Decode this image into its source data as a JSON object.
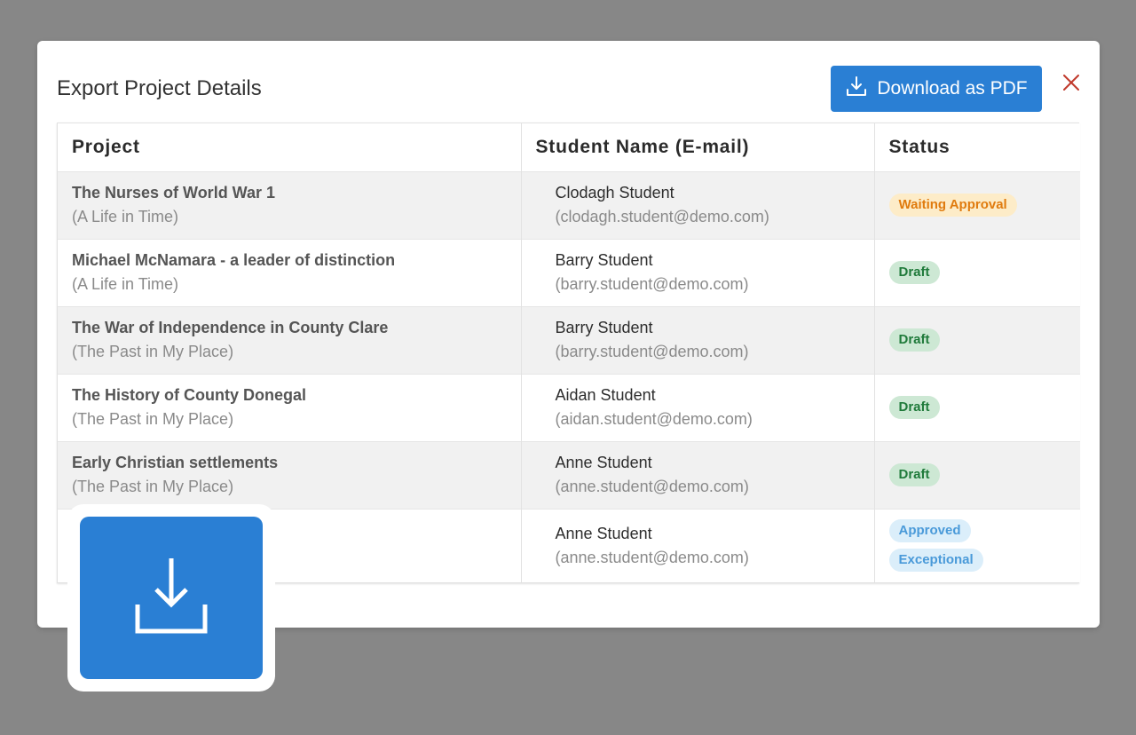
{
  "modal": {
    "title": "Export Project Details",
    "download_label": "Download as PDF",
    "download_icon": "download-icon",
    "close_icon": "close-icon",
    "close_color": "#c0392b"
  },
  "table": {
    "headers": [
      "Project",
      "Student Name (E-mail)",
      "Status"
    ],
    "rows": [
      {
        "project": "The Nurses of World War 1",
        "category": "(A Life in Time)",
        "student": "Clodagh Student",
        "email": "(clodagh.student@demo.com)",
        "statuses": [
          "Waiting Approval"
        ]
      },
      {
        "project": "Michael McNamara - a leader of distinction",
        "category": "(A Life in Time)",
        "student": "Barry Student",
        "email": "(barry.student@demo.com)",
        "statuses": [
          "Draft"
        ]
      },
      {
        "project": "The War of Independence in County Clare",
        "category": "(The Past in My Place)",
        "student": "Barry Student",
        "email": "(barry.student@demo.com)",
        "statuses": [
          "Draft"
        ]
      },
      {
        "project": "The History of County Donegal",
        "category": "(The Past in My Place)",
        "student": "Aidan Student",
        "email": "(aidan.student@demo.com)",
        "statuses": [
          "Draft"
        ]
      },
      {
        "project": "Early Christian settlements",
        "category": "(The Past in My Place)",
        "student": "Anne Student",
        "email": "(anne.student@demo.com)",
        "statuses": [
          "Draft"
        ]
      },
      {
        "project": "",
        "category": "",
        "student": "Anne Student",
        "email": "(anne.student@demo.com)",
        "statuses": [
          "Approved",
          "Exceptional"
        ]
      }
    ]
  },
  "overlay": {
    "icon": "download-icon",
    "color": "#2a7fd4"
  },
  "colors": {
    "accent": "#2a7fd4",
    "waiting": "#e07b0e",
    "draft": "#1f7a3a",
    "approved": "#4a9ad9"
  }
}
